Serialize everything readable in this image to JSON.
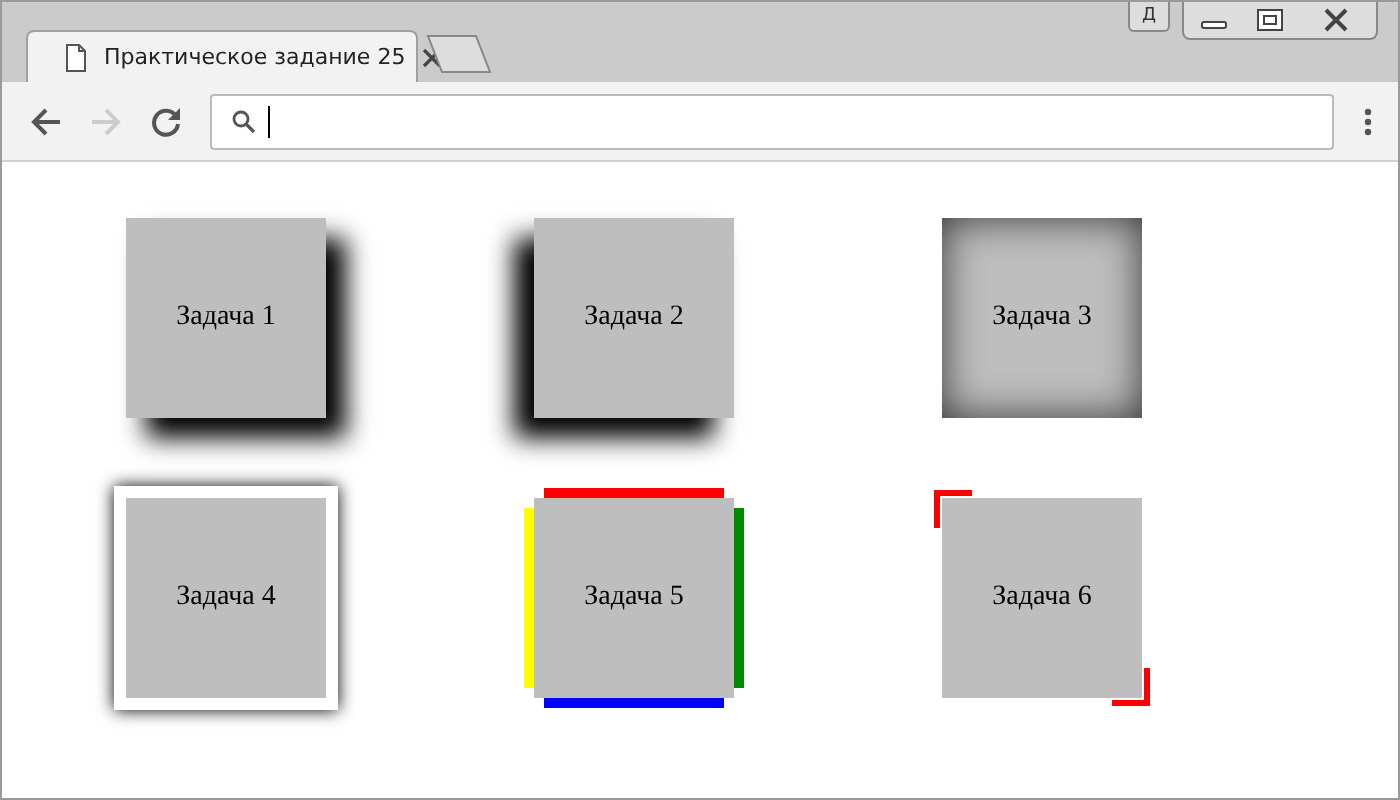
{
  "window": {
    "profile_badge": "Д"
  },
  "tab": {
    "title": "Практическое задание 25"
  },
  "toolbar": {
    "forward_disabled": true
  },
  "boxes": [
    {
      "label": "Задача 1",
      "kind": "shadow-right"
    },
    {
      "label": "Задача 2",
      "kind": "shadow-left"
    },
    {
      "label": "Задача 3",
      "kind": "inset"
    },
    {
      "label": "Задача 4",
      "kind": "framed"
    },
    {
      "label": "Задача 5",
      "kind": "bars"
    },
    {
      "label": "Задача 6",
      "kind": "corners"
    }
  ]
}
